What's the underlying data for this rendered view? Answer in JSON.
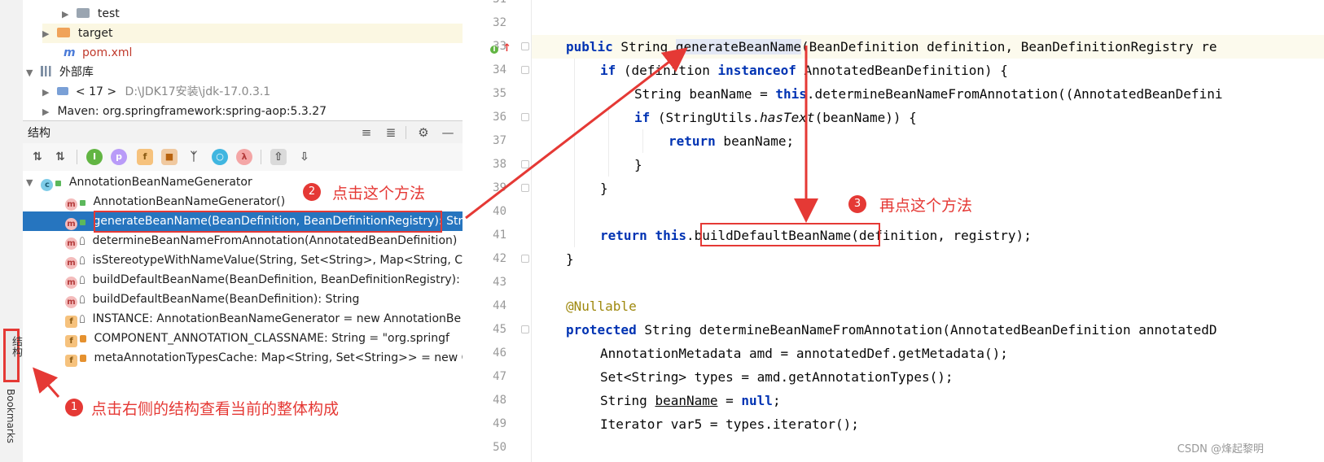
{
  "project_tree": {
    "rows": [
      {
        "label": "test",
        "type": "folder"
      },
      {
        "label": "target",
        "type": "folder-orange"
      },
      {
        "label": "pom.xml",
        "type": "maven"
      },
      {
        "label": "外部库",
        "type": "library"
      },
      {
        "label": "< 17 >",
        "path": "D:\\JDK17安装\\jdk-17.0.3.1",
        "type": "jdk"
      },
      {
        "label": "Maven: org.springframework:spring-aop:5.3.27",
        "type": "library"
      }
    ]
  },
  "structure_panel": {
    "title": "结构",
    "header_icons": [
      "expand-all-icon",
      "collapse-all-icon",
      "gear-icon",
      "minimize-icon"
    ],
    "root_class": "AnnotationBeanNameGenerator",
    "members": [
      {
        "icon": "m",
        "visibility": "public",
        "label": "AnnotationBeanNameGenerator()"
      },
      {
        "icon": "m",
        "visibility": "public",
        "label": "generateBeanName(BeanDefinition, BeanDefinitionRegistry): Stri",
        "selected": true
      },
      {
        "icon": "m",
        "visibility": "package",
        "label": "determineBeanNameFromAnnotation(AnnotatedBeanDefinition)"
      },
      {
        "icon": "m",
        "visibility": "package",
        "label": "isStereotypeWithNameValue(String, Set<String>, Map<String, C"
      },
      {
        "icon": "m",
        "visibility": "package",
        "label": "buildDefaultBeanName(BeanDefinition, BeanDefinitionRegistry):"
      },
      {
        "icon": "m",
        "visibility": "package",
        "label": "buildDefaultBeanName(BeanDefinition): String"
      },
      {
        "icon": "f",
        "visibility": "package",
        "label": "INSTANCE: AnnotationBeanNameGenerator = new AnnotationBe"
      },
      {
        "icon": "f",
        "visibility": "private",
        "label": "COMPONENT_ANNOTATION_CLASSNAME: String = \"org.springf"
      },
      {
        "icon": "f",
        "visibility": "private",
        "label": "metaAnnotationTypesCache: Map<String, Set<String>> = new C"
      }
    ]
  },
  "side_tabs": {
    "structure": "结构",
    "bookmarks": "Bookmarks"
  },
  "editor": {
    "line_numbers": [
      "31",
      "32",
      "33",
      "34",
      "35",
      "36",
      "37",
      "38",
      "39",
      "40",
      "41",
      "42",
      "43",
      "44",
      "45",
      "46",
      "47",
      "48",
      "49",
      "50"
    ],
    "lines": {
      "l33_kw": "public",
      "l33_a": " String ",
      "l33_method": "generateBeanName",
      "l33_b": "(BeanDefinition definition, BeanDefinitionRegistry re",
      "l34_kw": "if",
      "l34_a": " (definition ",
      "l34_kw2": "instanceof",
      "l34_b": " AnnotatedBeanDefinition) {",
      "l35_a": "String beanName = ",
      "l35_kw": "this",
      "l35_b": ".determineBeanNameFromAnnotation((AnnotatedBeanDefini",
      "l36_kw": "if",
      "l36_a": " (StringUtils.",
      "l36_it": "hasText",
      "l36_b": "(beanName)) {",
      "l37_kw": "return",
      "l37_a": " beanName;",
      "l38": "}",
      "l39": "}",
      "l41_kw": "return",
      "l41_a": " ",
      "l41_kw2": "this",
      "l41_b": ".",
      "l41_method": "buildDefaultBeanName",
      "l41_c": "(definition, registry);",
      "l42": "}",
      "l44": "@Nullable",
      "l45_kw": "protected",
      "l45_a": " String determineBeanNameFromAnnotation(AnnotatedBeanDefinition annotatedD",
      "l46": "AnnotationMetadata amd = annotatedDef.getMetadata();",
      "l47": "Set<String> types = amd.getAnnotationTypes();",
      "l48_a": "String ",
      "l48_ul": "beanName",
      "l48_b": " = ",
      "l48_kw": "null",
      "l48_c": ";",
      "l49": "Iterator var5 = types.iterator();"
    }
  },
  "annotations": {
    "step1_num": "1",
    "step1_text": "点击右侧的结构查看当前的整体构成",
    "step2_num": "2",
    "step2_text": "点击这个方法",
    "step3_num": "3",
    "step3_text": "再点这个方法",
    "color": "#e53935"
  },
  "watermark": "CSDN @烽起黎明"
}
